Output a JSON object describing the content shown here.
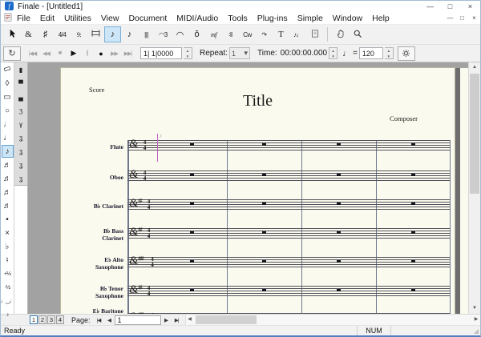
{
  "window": {
    "title": "Finale - [Untitled1]",
    "controls": {
      "minimize": "—",
      "maximize": "□",
      "close": "×"
    }
  },
  "menu": {
    "items": [
      "File",
      "Edit",
      "Utilities",
      "View",
      "Document",
      "MIDI/Audio",
      "Tools",
      "Plug-ins",
      "Simple",
      "Window",
      "Help"
    ],
    "mdi_controls": {
      "minimize": "—",
      "restore": "□",
      "close": "×"
    }
  },
  "toolbar_main": {
    "buttons": [
      {
        "name": "selection-tool",
        "icon": "cursor"
      },
      {
        "name": "staff-tool",
        "glyph": "&",
        "serif": true
      },
      {
        "name": "key-signature-tool",
        "glyph": "♯"
      },
      {
        "name": "time-signature-tool",
        "glyph": "4/4",
        "small": true
      },
      {
        "name": "clef-tool",
        "glyph": "9:",
        "serif": true,
        "small": true
      },
      {
        "name": "measure-tool",
        "icon": "measure"
      },
      {
        "name": "simple-entry-tool",
        "glyph": "♪",
        "selected": true
      },
      {
        "name": "speedy-entry-tool",
        "glyph": "♪",
        "italic": true
      },
      {
        "name": "hyperscribe-tool",
        "glyph": "|||",
        "small": true
      },
      {
        "name": "tuplet-tool",
        "glyph": "◠3",
        "small": true
      },
      {
        "name": "smart-shape-tool",
        "glyph": "◠"
      },
      {
        "name": "articulation-tool",
        "glyph": "ŏ"
      },
      {
        "name": "expression-tool",
        "glyph": "mf",
        "serif": true,
        "italic": true,
        "small": true
      },
      {
        "name": "repeat-tool",
        "glyph": "∶‖",
        "small": true
      },
      {
        "name": "chord-tool",
        "glyph": "Cw",
        "small": true
      },
      {
        "name": "lyrics-tool",
        "glyph": "↷",
        "small": true
      },
      {
        "name": "text-tool",
        "glyph": "T",
        "serif": true
      },
      {
        "name": "note-mover-tool",
        "glyph": "♪♩",
        "small": true
      },
      {
        "name": "page-layout-tool",
        "icon": "page"
      },
      {
        "name": "hand-grabber-tool",
        "icon": "hand",
        "sep_before": true
      },
      {
        "name": "zoom-tool",
        "icon": "magnifier"
      }
    ]
  },
  "toolbar_playback": {
    "loop_button": "↻",
    "transport": [
      {
        "name": "rewind-to-start-button",
        "glyph": "|◀◀",
        "disabled": true
      },
      {
        "name": "rewind-button",
        "glyph": "◀◀",
        "disabled": true
      },
      {
        "name": "stop-button",
        "glyph": "■",
        "disabled": true
      },
      {
        "name": "play-button",
        "glyph": "▶",
        "disabled": false
      },
      {
        "name": "pause-button",
        "glyph": "||",
        "disabled": true
      },
      {
        "name": "record-button",
        "glyph": "●",
        "disabled": false
      },
      {
        "name": "fast-forward-button",
        "glyph": "▶▶",
        "disabled": true
      },
      {
        "name": "forward-to-end-button",
        "glyph": "▶▶|",
        "disabled": true
      }
    ],
    "counter_value": "1| 1|0000",
    "repeat_label": "Repeat:",
    "repeat_value": "1",
    "dropdown_arrow": "▾",
    "time_label": "Time:",
    "time_value": "00:00:00.000",
    "tempo_note": "♩",
    "equals": "=",
    "tempo_value": "120",
    "spinner_up": "▲",
    "spinner_down": "▼"
  },
  "palette_notes": {
    "items": [
      {
        "name": "eraser",
        "icon": "eraser"
      },
      {
        "name": "repitch",
        "glyph": "◊"
      },
      {
        "name": "double-whole-note",
        "glyph": "▭"
      },
      {
        "name": "whole-note",
        "glyph": "○"
      },
      {
        "name": "half-note",
        "glyph": "♩",
        "half": true
      },
      {
        "name": "quarter-note",
        "glyph": "♩"
      },
      {
        "name": "eighth-note",
        "glyph": "♪",
        "selected": true
      },
      {
        "name": "sixteenth-note",
        "glyph": "♬"
      },
      {
        "name": "thirty-second-note",
        "glyph": "♬"
      },
      {
        "name": "sixty-fourth-note",
        "glyph": "♬"
      },
      {
        "name": "hundred-twenty-eighth-note",
        "glyph": "♬"
      },
      {
        "name": "augmentation-dot",
        "glyph": "•"
      },
      {
        "name": "double-sharp",
        "glyph": "×"
      },
      {
        "name": "flat",
        "glyph": "♭"
      },
      {
        "name": "natural",
        "glyph": "♮"
      },
      {
        "name": "half-step-up",
        "glyph": "+½",
        "small": true
      },
      {
        "name": "half-step-down",
        "glyph": "-½",
        "small": true
      },
      {
        "name": "tie",
        "glyph": "♩‿♩",
        "small": true
      },
      {
        "name": "grace-note",
        "glyph": "♪",
        "small": true
      }
    ]
  },
  "palette_rests": {
    "items": [
      {
        "name": "double-whole-rest",
        "glyph": "▮"
      },
      {
        "name": "whole-rest",
        "glyph": "▀"
      },
      {
        "name": "half-rest",
        "glyph": "▄"
      },
      {
        "name": "quarter-rest",
        "glyph": "ʒ"
      },
      {
        "name": "eighth-rest",
        "glyph": "ɣ"
      },
      {
        "name": "sixteenth-rest",
        "glyph": "ʓ"
      },
      {
        "name": "thirty-second-rest",
        "glyph": "ʓ"
      },
      {
        "name": "sixty-fourth-rest",
        "glyph": "ʓ"
      },
      {
        "name": "hundred-twenty-eighth-rest",
        "glyph": "ʓ"
      }
    ]
  },
  "score": {
    "part_label": "Score",
    "title": "Title",
    "composer": "Composer",
    "clef_glyph": "&",
    "sharp_glyph": "♯",
    "cursor_glyph": "♪",
    "time_signature": {
      "numerator": "4",
      "denominator": "4"
    },
    "measures_per_system": 4,
    "staves": [
      {
        "name": "flute",
        "label_lines": [
          "Flute"
        ],
        "sharps": 0,
        "has_cursor": true
      },
      {
        "name": "oboe",
        "label_lines": [
          "Oboe"
        ],
        "sharps": 0
      },
      {
        "name": "bb-clarinet",
        "label_lines": [
          "B♭ Clarinet"
        ],
        "sharps": 2
      },
      {
        "name": "bb-bass-clarinet",
        "label_lines": [
          "B♭ Bass",
          "Clarinet"
        ],
        "sharps": 2
      },
      {
        "name": "eb-alto-saxophone",
        "label_lines": [
          "E♭ Alto",
          "Saxophone"
        ],
        "sharps": 3
      },
      {
        "name": "bb-tenor-saxophone",
        "label_lines": [
          "B♭ Tenor",
          "Saxophone"
        ],
        "sharps": 2
      },
      {
        "name": "eb-baritone",
        "label_lines": [
          "E♭ Baritone"
        ],
        "sharps": 3,
        "clipped": true
      }
    ]
  },
  "nav": {
    "page_tabs": [
      "1",
      "2",
      "3",
      "4"
    ],
    "selected_tab": "1",
    "page_label": "Page:",
    "first": "|◀",
    "prev": "◀",
    "page_value": "1",
    "next": "▶",
    "last": "▶|"
  },
  "scrollbar": {
    "up": "▲",
    "down": "▼",
    "left": "◀",
    "right": "▶"
  },
  "status": {
    "ready": "Ready",
    "num": "NUM",
    "grip": "◢"
  },
  "colors": {
    "selected_bg": "#cde6f7",
    "selected_border": "#7ab0d8",
    "page": "#fbfaee",
    "doc_bg": "#a2a2a2",
    "entry_cursor": "#c25fc4"
  }
}
